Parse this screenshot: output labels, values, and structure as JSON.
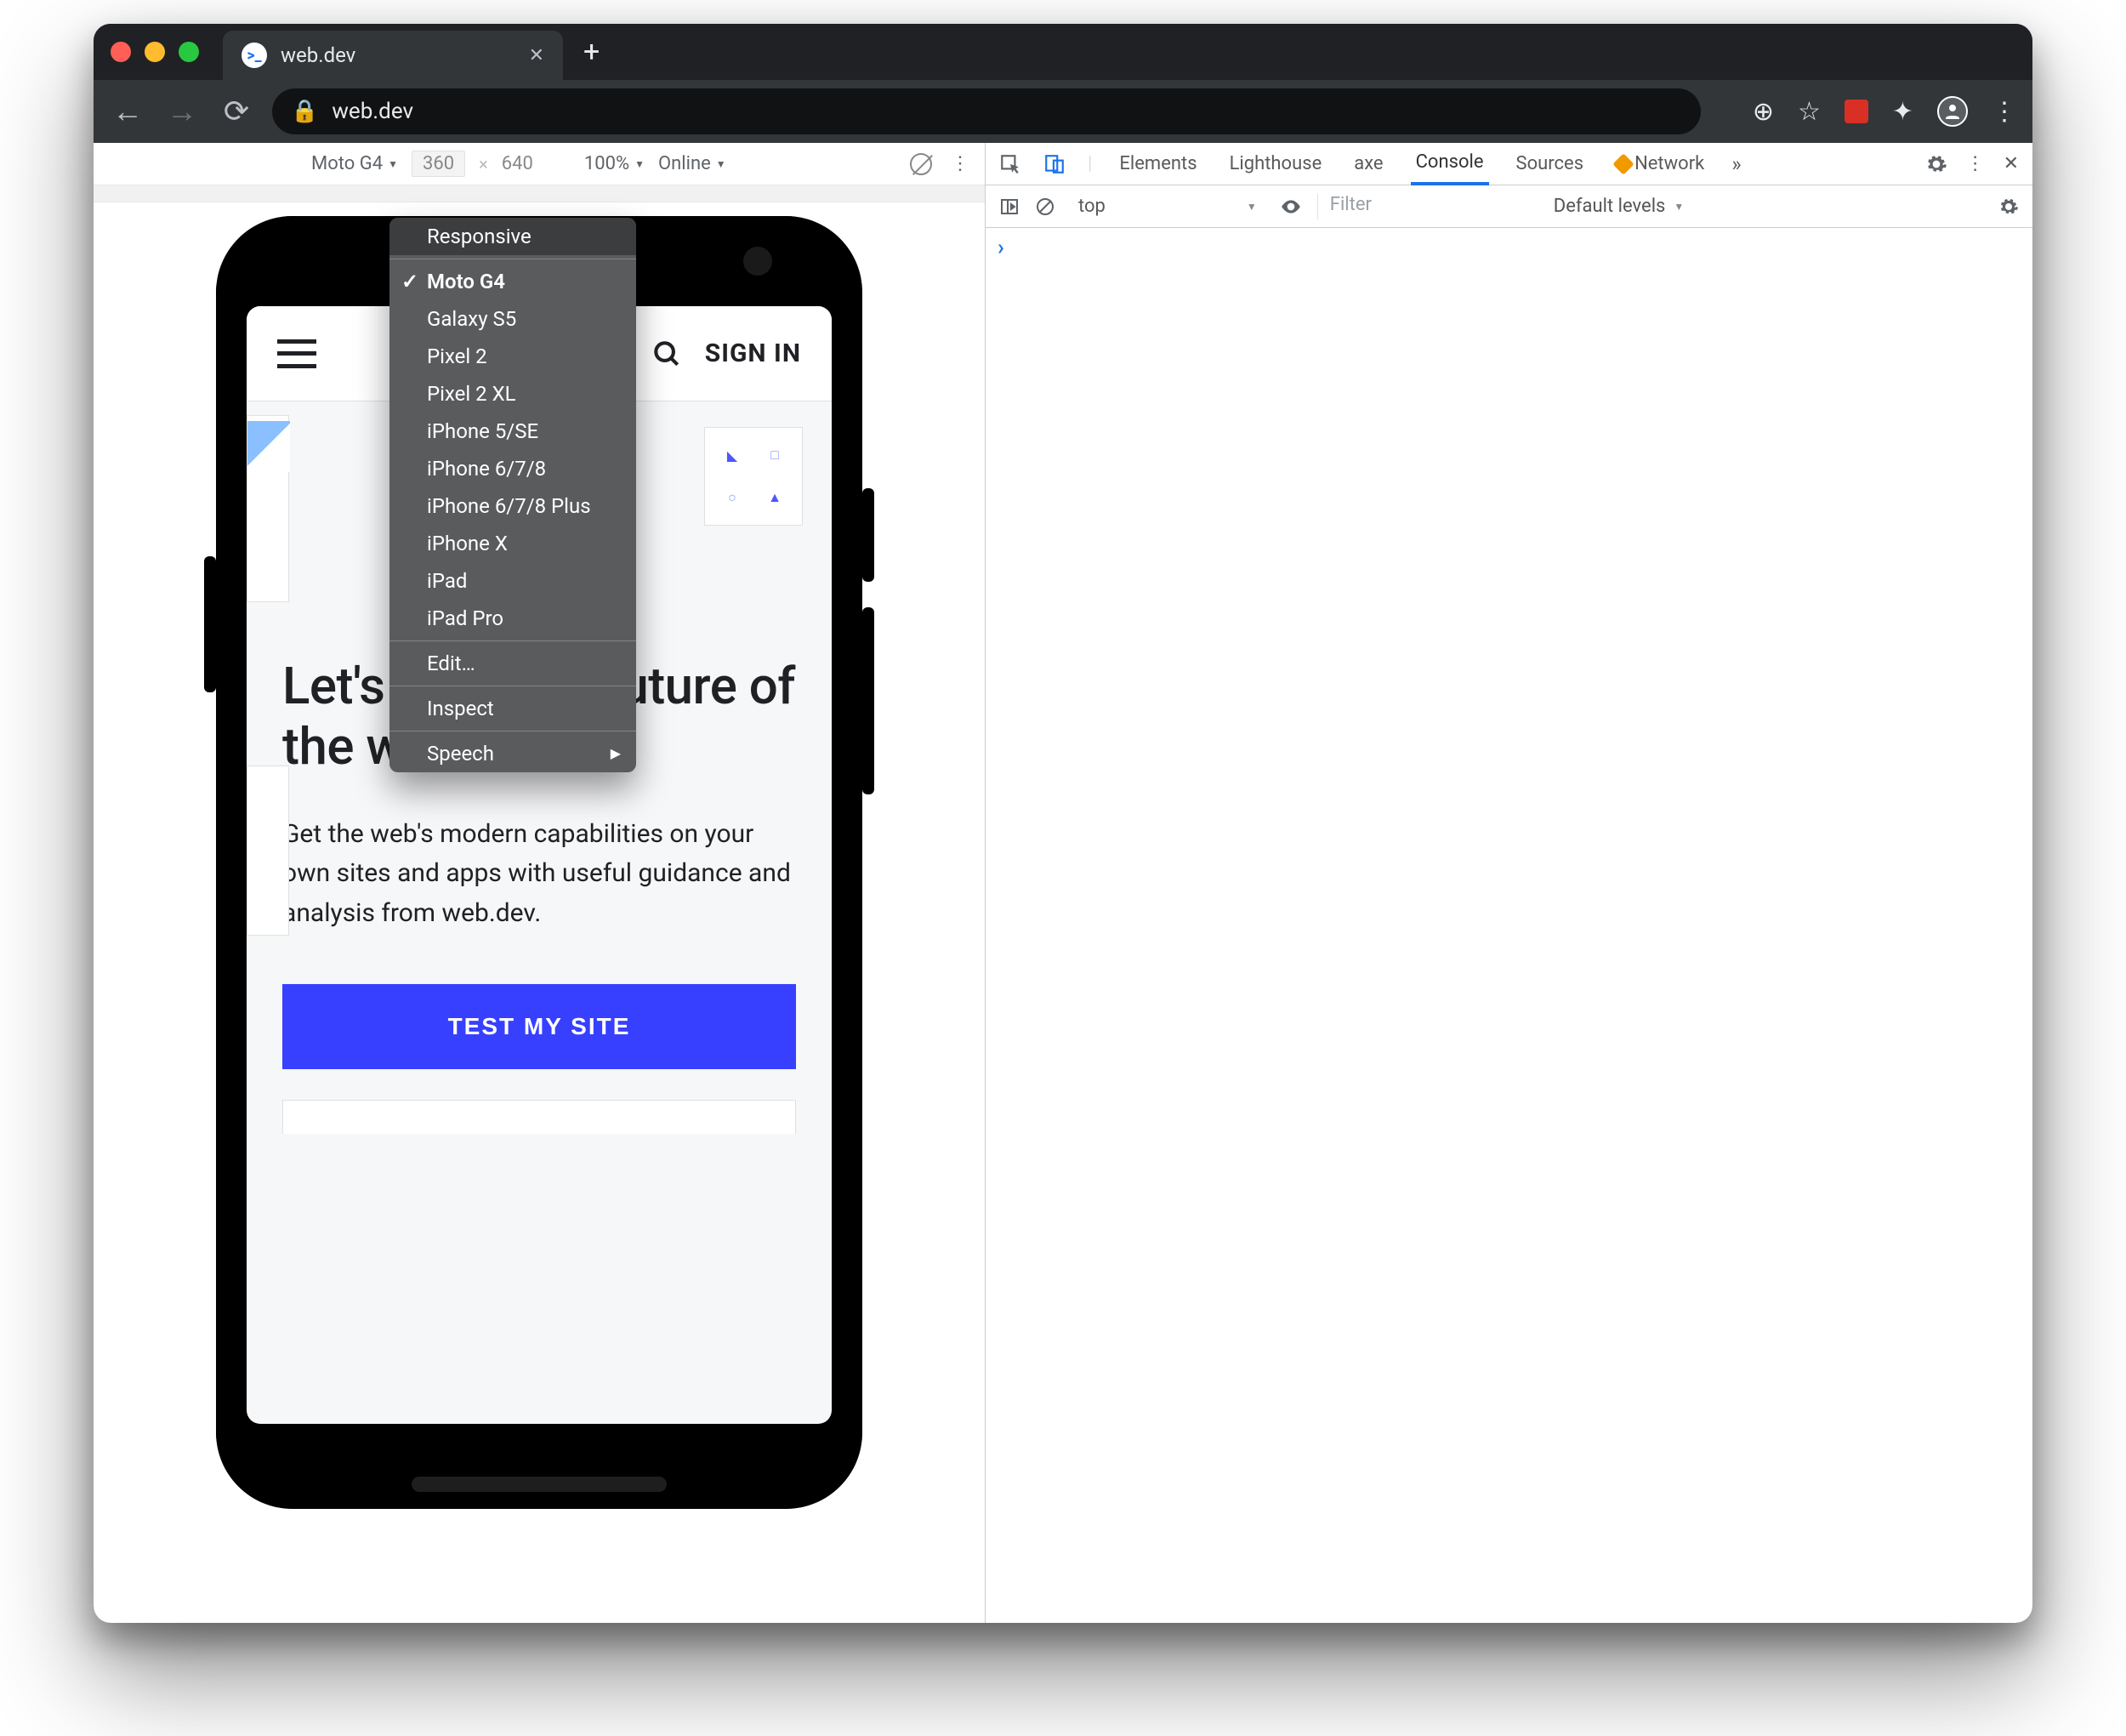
{
  "browser": {
    "tab_title": "web.dev",
    "url_text": "web.dev",
    "favicon_glyph": ">_"
  },
  "device_toolbar": {
    "device": "Moto G4",
    "width": "360",
    "height": "640",
    "zoom": "100%",
    "throttle": "Online"
  },
  "device_menu": {
    "header": "Responsive",
    "items": [
      "Moto G4",
      "Galaxy S5",
      "Pixel 2",
      "Pixel 2 XL",
      "iPhone 5/SE",
      "iPhone 6/7/8",
      "iPhone 6/7/8 Plus",
      "iPhone X",
      "iPad",
      "iPad Pro"
    ],
    "selected_index": 0,
    "edit": "Edit…",
    "inspect": "Inspect",
    "speech": "Speech"
  },
  "devtools": {
    "tabs": [
      "Elements",
      "Lighthouse",
      "axe",
      "Console",
      "Sources",
      "Network"
    ],
    "active_tab_index": 3,
    "warn_tab_index": 5,
    "console": {
      "context": "top",
      "filter_placeholder": "Filter",
      "levels": "Default levels"
    }
  },
  "page": {
    "sign_in": "SIGN IN",
    "headline": "Let's build the future of the web",
    "subhead": "Get the web's modern capabilities on your own sites and apps with useful guidance and analysis from web.dev.",
    "cta": "TEST MY SITE"
  },
  "icons": {
    "search_icon": "search-icon",
    "menu_icon": "menu-icon"
  }
}
